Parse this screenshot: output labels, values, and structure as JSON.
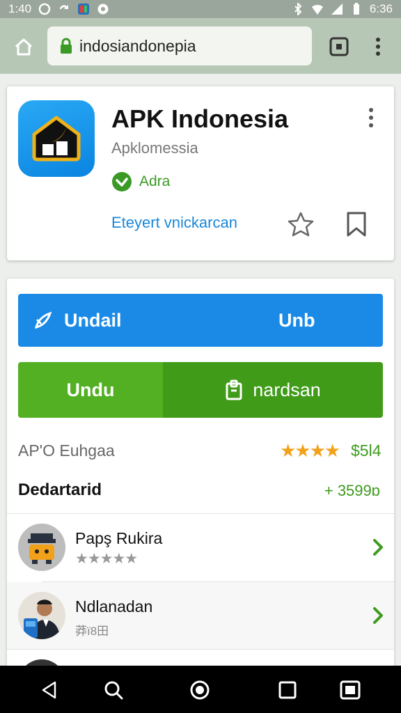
{
  "status_bar": {
    "time": "1:40",
    "right_text": "6:36",
    "icons": [
      "circle-icon",
      "sync-icon",
      "app-notification-icon",
      "record-icon",
      "bluetooth-icon",
      "wifi-icon",
      "signal-icon",
      "battery-icon"
    ]
  },
  "browser": {
    "url": "indosiandonepia",
    "icons": [
      "home-icon",
      "lock-icon",
      "tabs-icon",
      "overflow-menu-icon"
    ]
  },
  "app": {
    "title": "APK Indonesia",
    "developer": "Apklomessia",
    "verified_label": "Adra",
    "link_text": "Eteyert vnickarcan",
    "accent": "#1a88d8"
  },
  "actions": {
    "primary_left_label": "Undail",
    "primary_right_label": "Unb",
    "secondary_left_label": "Undu",
    "secondary_right_label": "nardsan",
    "primary_color": "#1b8ae6",
    "secondary_color": "#52b022"
  },
  "rating": {
    "label": "AP'O Euhgaa",
    "stars_text": "★★★★",
    "stars_value": 4,
    "value": "$5l4"
  },
  "section": {
    "title": "Dedartarid",
    "count": "+ 3599ɒ"
  },
  "list": [
    {
      "name": "Papş Rukira",
      "stars_text": "★★★★★",
      "avatar": "robot-avatar"
    },
    {
      "name": "Ndlanadan",
      "sub": "莽ï8田",
      "avatar": "person-avatar"
    }
  ]
}
